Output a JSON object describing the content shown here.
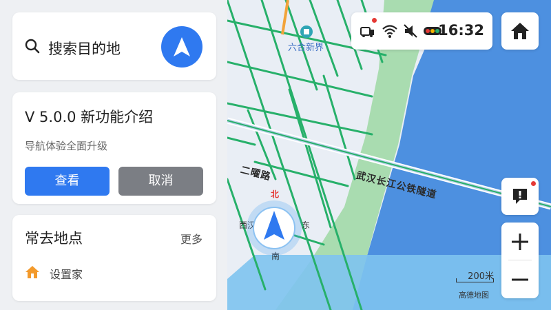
{
  "search": {
    "placeholder": "搜索目的地"
  },
  "update": {
    "title": "V 5.0.0 新功能介绍",
    "subtitle": "导航体验全面升级",
    "view_label": "查看",
    "cancel_label": "取消"
  },
  "frequent": {
    "title": "常去地点",
    "more_label": "更多",
    "items": [
      {
        "label": "设置家",
        "icon": "home-icon"
      }
    ]
  },
  "status": {
    "time": "16:32",
    "icons": [
      "car-icon",
      "wifi-icon",
      "mute-icon",
      "traffic-light-icon"
    ]
  },
  "map": {
    "poi": "六合新界",
    "road_tunnel": "武汉长江公铁隧道",
    "road_erlu": "二曜路",
    "compass": {
      "north": "北",
      "south": "南",
      "east": "东",
      "west": "西汉"
    },
    "scale": "200米",
    "brand": "高德地图"
  },
  "colors": {
    "accent": "#2f79f0",
    "map_land": "#e9eef5",
    "map_river": "#4d90e0",
    "map_park": "#a9dcb0",
    "road_green": "#27b06a"
  }
}
